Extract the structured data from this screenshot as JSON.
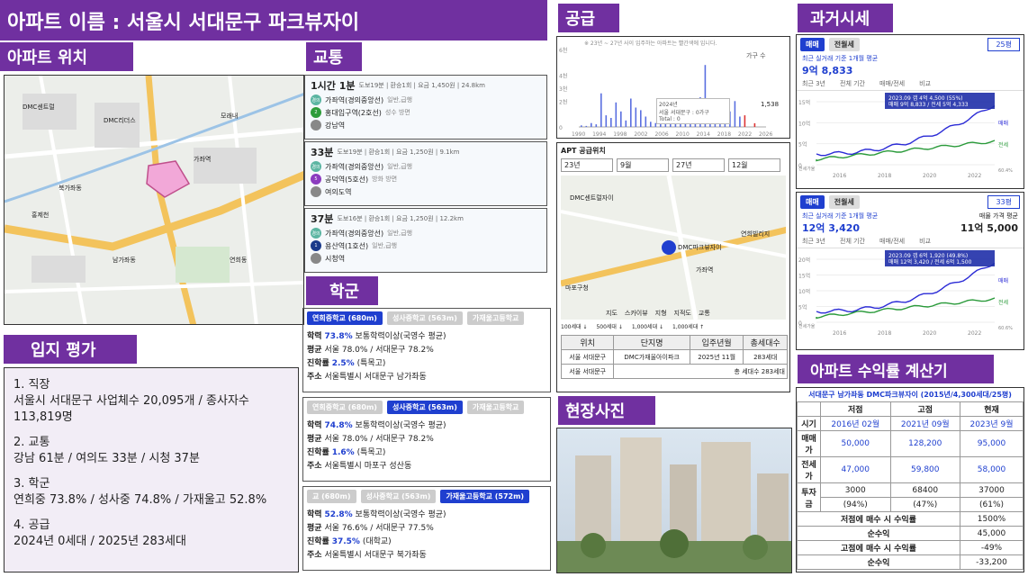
{
  "title": "아파트 이름 : 서울시 서대문구 파크뷰자이",
  "sections": {
    "location": "아파트 위치",
    "traffic": "교통",
    "supply": "공급",
    "past_price": "과거시세",
    "school": "학군",
    "eval": "입지 평가",
    "site_photo": "현장사진",
    "calculator": "아파트 수익률 계산기"
  },
  "map": {
    "labels": [
      "DMC센트럴",
      "DMC리더스",
      "가좌역",
      "모래내",
      "북가좌동",
      "남가좌동",
      "연희동",
      "홍제천"
    ]
  },
  "traffic": [
    {
      "time": "1시간 1분",
      "meta": "도보19분 | 환승1회 | 요금 1,450원 | 24.8km",
      "stops": [
        {
          "icon": "경의",
          "name": "가좌역(경의중앙선)",
          "note": "일반,급행"
        },
        {
          "icon": "2",
          "name": "홍대입구역(2호선)",
          "note": "성수 방면"
        },
        {
          "icon": "",
          "name": "강남역",
          "note": ""
        }
      ]
    },
    {
      "time": "33분",
      "meta": "도보19분 | 환승1회 | 요금 1,250원 | 9.1km",
      "stops": [
        {
          "icon": "경의",
          "name": "가좌역(경의중앙선)",
          "note": "일반,급행"
        },
        {
          "icon": "5",
          "name": "공덕역(5호선)",
          "note": "방화 방면"
        },
        {
          "icon": "",
          "name": "여의도역",
          "note": ""
        }
      ]
    },
    {
      "time": "37분",
      "meta": "도보16분 | 환승1회 | 요금 1,250원 | 12.2km",
      "stops": [
        {
          "icon": "경의",
          "name": "가좌역(경의중앙선)",
          "note": "일반,급행"
        },
        {
          "icon": "1",
          "name": "용산역(1호선)",
          "note": "일반,급행"
        },
        {
          "icon": "",
          "name": "시청역",
          "note": ""
        }
      ]
    }
  ],
  "supply_chart": {
    "note": "※ 23년 ~ 27년 사이 입주하는 아파트는 빨간색에 입니다.",
    "legend": "가구 수",
    "tooltip": [
      "2024년",
      "서울 서대문구 : 0가구",
      "Total : 0"
    ],
    "side_value": "1,538",
    "y_ticks": [
      "6천",
      "4천",
      "3천",
      "2천",
      "0"
    ],
    "x_ticks": [
      "1990",
      "1994",
      "1998",
      "2002",
      "2006",
      "2010",
      "2014",
      "2018",
      "2022",
      "2026"
    ]
  },
  "chart_data": {
    "type": "bar",
    "ylabel": "",
    "ylim": [
      0,
      6000
    ],
    "x": [
      "1990",
      "1991",
      "1992",
      "1993",
      "1994",
      "1995",
      "1996",
      "1997",
      "1998",
      "1999",
      "2000",
      "2001",
      "2002",
      "2003",
      "2004",
      "2005",
      "2006",
      "2007",
      "2008",
      "2009",
      "2010",
      "2011",
      "2012",
      "2013",
      "2014",
      "2015",
      "2016",
      "2017",
      "2018",
      "2019",
      "2020",
      "2021",
      "2022",
      "2023",
      "2024",
      "2025"
    ],
    "values": [
      120,
      80,
      300,
      200,
      2600,
      900,
      700,
      1900,
      1200,
      500,
      2200,
      1500,
      1300,
      800,
      400,
      300,
      1000,
      900,
      300,
      400,
      600,
      400,
      500,
      1900,
      2300,
      4800,
      1500,
      1200,
      1700,
      700,
      1200,
      2000,
      800,
      900,
      0,
      283
    ]
  },
  "apt_supply": {
    "title": "APT 공급위치",
    "selects": [
      "23년",
      "9월",
      "27년",
      "12월"
    ],
    "map_labels": [
      "DMC센트럴자이",
      "DMC파크뷰자이",
      "가좌역",
      "마포구청",
      "연희빌리지"
    ],
    "legend": [
      "100세대 ↓",
      "500세대 ↓",
      "1,000세대 ↓",
      "1,000세대 ↑"
    ],
    "tabs": [
      "지도",
      "스카이뷰",
      "지형",
      "지적도",
      "교통"
    ],
    "table_headers": [
      "위치",
      "단지명",
      "입주년월",
      "총세대수"
    ],
    "rows": [
      [
        "서울 서대문구",
        "DMC가재울아이파크",
        "2025년 11월",
        "283세대"
      ],
      [
        "서울 서대문구",
        "",
        "",
        "총 세대수 283세대"
      ]
    ]
  },
  "past_price": [
    {
      "tabs": [
        "매매",
        "전월세"
      ],
      "size": "25평",
      "label": "최근 실거래 기준 1개월 평균",
      "price": "9억 8,833",
      "range_tabs": [
        "최근 3년",
        "전체 기간",
        "매매/전세",
        "비교"
      ],
      "tip": [
        "2023.09 갭 4억 4,500 (55%)",
        "매매 9억 8,833 / 전세 5억 4,333"
      ],
      "y": [
        "15억",
        "10억",
        "5억",
        "0"
      ],
      "right": [
        "매매",
        "전세"
      ],
      "x": [
        "2016",
        "2018",
        "2020",
        "2022"
      ],
      "bottom": "전세가율",
      "pct": "60.4%"
    },
    {
      "tabs": [
        "매매",
        "전월세"
      ],
      "size": "33평",
      "label": "최근 실거래 기준 1개월 평균",
      "price": "12억 3,420",
      "ask_label": "매물 가격 평균",
      "ask": "11억 5,000",
      "range_tabs": [
        "최근 3년",
        "전체 기간",
        "매매/전세",
        "비교"
      ],
      "tip": [
        "2023.09 갭 6억 1,920 (49.8%)",
        "매매 12억 3,420 / 전세 6억 1,500"
      ],
      "y": [
        "20억",
        "15억",
        "10억",
        "5억",
        "0"
      ],
      "right": [
        "매매",
        "전세"
      ],
      "x": [
        "2016",
        "2018",
        "2020",
        "2022"
      ],
      "bottom": "전세가율",
      "pct": "60.6%"
    }
  ],
  "schools": [
    {
      "tabs": [
        "연희중학교 (680m)",
        "성사중학교 (563m)",
        "가재울고등학교"
      ],
      "active": 0,
      "rate": "73.8%",
      "rate_note": "보통학력이상(국영수 평균)",
      "avg": "서울 78.0% / 서대문구 78.2%",
      "adv": "2.5%",
      "adv_note": "(특목고)",
      "addr": "서울특별시 서대문구 남가좌동"
    },
    {
      "tabs": [
        "연희중학교 (680m)",
        "성사중학교 (563m)",
        "가재울고등학교"
      ],
      "active": 1,
      "rate": "74.8%",
      "rate_note": "보통학력이상(국영수 평균)",
      "avg": "서울 78.0% / 서대문구 78.2%",
      "adv": "1.6%",
      "adv_note": "(특목고)",
      "addr": "서울특별시 마포구 성산동"
    },
    {
      "tabs": [
        "교 (680m)",
        "성사중학교 (563m)",
        "가재울고등학교 (572m)"
      ],
      "active": 2,
      "rate": "52.8%",
      "rate_note": "보통학력이상(국영수 평균)",
      "avg": "서울 76.6% / 서대문구 77.5%",
      "adv": "37.5%",
      "adv_note": "(대학교)",
      "addr": "서울특별시 서대문구 북가좌동"
    }
  ],
  "school_labels": {
    "rate": "학력",
    "avg": "평균",
    "adv": "진학률",
    "addr": "주소"
  },
  "eval": [
    {
      "h": "1. 직장",
      "b": "서울시 서대문구 사업체수 20,095개 / 종사자수 113,819명"
    },
    {
      "h": "2. 교통",
      "b": "강남 61분 / 여의도 33분 / 시청 37분"
    },
    {
      "h": "3. 학군",
      "b": "연희중 73.8% / 성사중 74.8% / 가재울고 52.8%"
    },
    {
      "h": "4. 공급",
      "b": "2024년 0세대 / 2025년 283세대"
    }
  ],
  "calc": {
    "title": "서대문구 남가좌동 DMC파크뷰자이 (2015년/4,300세대/25평)",
    "headers": [
      "",
      "저점",
      "고점",
      "현재"
    ],
    "rows": [
      [
        "시기",
        "2016년 02월",
        "2021년 09월",
        "2023년 9월"
      ],
      [
        "매매가",
        "50,000",
        "128,200",
        "95,000"
      ],
      [
        "전세가",
        "47,000",
        "59,800",
        "58,000"
      ]
    ],
    "invest": {
      "label": "투자금",
      "vals": [
        "3000",
        "68400",
        "37000"
      ],
      "pcts": [
        "(94%)",
        "(47%)",
        "(61%)"
      ]
    },
    "summary": [
      [
        "저점에 매수 시 수익률",
        "1500%"
      ],
      [
        "순수익",
        "45,000"
      ],
      [
        "고점에 매수 시 수익률",
        "-49%"
      ],
      [
        "순수익",
        "-33,200"
      ]
    ]
  }
}
